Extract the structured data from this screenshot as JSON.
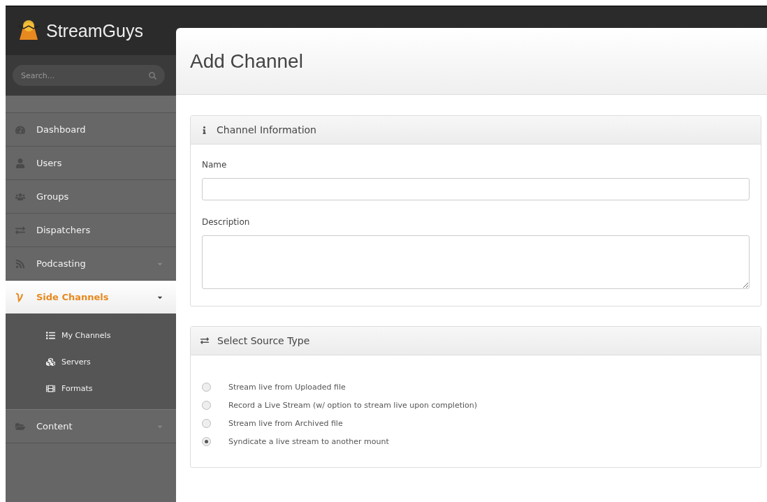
{
  "brand": {
    "name": "StreamGuys"
  },
  "search": {
    "placeholder": "Search..."
  },
  "nav": [
    {
      "label": "Dashboard",
      "selected": false,
      "expandable": false
    },
    {
      "label": "Users",
      "selected": false,
      "expandable": false
    },
    {
      "label": "Groups",
      "selected": false,
      "expandable": false
    },
    {
      "label": "Dispatchers",
      "selected": false,
      "expandable": false
    },
    {
      "label": "Podcasting",
      "selected": false,
      "expandable": true
    },
    {
      "label": "Side Channels",
      "selected": true,
      "expandable": true,
      "children": [
        {
          "label": "My Channels"
        },
        {
          "label": "Servers"
        },
        {
          "label": "Formats"
        }
      ]
    },
    {
      "label": "Content",
      "selected": false,
      "expandable": true
    }
  ],
  "page_title": "Add Channel",
  "channel_info": {
    "title": "Channel Information",
    "fields": [
      {
        "label": "Name",
        "kind": "input"
      },
      {
        "label": "Description",
        "kind": "textarea"
      }
    ]
  },
  "source_type": {
    "title": "Select Source Type",
    "options": [
      {
        "label": "Stream live from Uploaded file",
        "selected": false
      },
      {
        "label": "Record a Live Stream (w/ option to stream live upon completion)",
        "selected": false
      },
      {
        "label": "Stream live from Archived file",
        "selected": false
      },
      {
        "label": "Syndicate a live stream to another mount",
        "selected": true
      }
    ]
  }
}
